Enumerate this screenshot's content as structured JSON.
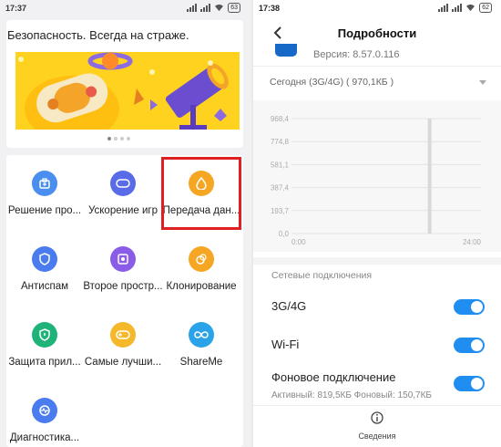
{
  "left": {
    "status": {
      "time": "17:37",
      "battery": "63"
    },
    "title": "Безопасность. Всегда на страже.",
    "tiles": [
      {
        "label": "Решение про...",
        "icon": "briefcase-icon",
        "color": "#4a8ef0"
      },
      {
        "label": "Ускорение игр",
        "icon": "gamepad-icon",
        "color": "#5a6be8"
      },
      {
        "label": "Передача дан...",
        "icon": "data-drop-icon",
        "color": "#f5a623"
      },
      {
        "label": "Антиспам",
        "icon": "shield-icon",
        "color": "#4a7cf0"
      },
      {
        "label": "Второе простр...",
        "icon": "second-space-icon",
        "color": "#8a5ce8"
      },
      {
        "label": "Клонирование",
        "icon": "clone-icon",
        "color": "#f5a623"
      },
      {
        "label": "Защита прил...",
        "icon": "app-lock-icon",
        "color": "#1fb37a"
      },
      {
        "label": "Самые лучши...",
        "icon": "games-icon",
        "color": "#f5b82a"
      },
      {
        "label": "ShareMe",
        "icon": "infinity-icon",
        "color": "#2aa3e8"
      },
      {
        "label": "Диагностика...",
        "icon": "diagnostics-icon",
        "color": "#4a7cf0"
      }
    ]
  },
  "right": {
    "status": {
      "time": "17:38",
      "battery": "62"
    },
    "title": "Подробности",
    "version": "Версия: 8.57.0.116",
    "period": "Сегодня (3G/4G)  ( 970,1КБ )",
    "section_title": "Сетевые подключения",
    "rows": [
      {
        "label": "3G/4G",
        "on": true
      },
      {
        "label": "Wi-Fi",
        "on": true
      },
      {
        "label": "Фоновое подключение",
        "on": true
      }
    ],
    "background_detail": "Активный: 819,5КБ  Фоновый: 150,7КБ",
    "bottom_tab": "Сведения"
  },
  "chart_data": {
    "type": "bar",
    "y_ticks": [
      "968,4",
      "774,8",
      "581,1",
      "387,4",
      "193,7",
      "0,0"
    ],
    "x_ticks": [
      "0:00",
      "24:00"
    ],
    "ylim": [
      0,
      968.4
    ],
    "x": [
      17.5
    ],
    "values": [
      970.1
    ],
    "bar_color": "#d9d9d9"
  }
}
